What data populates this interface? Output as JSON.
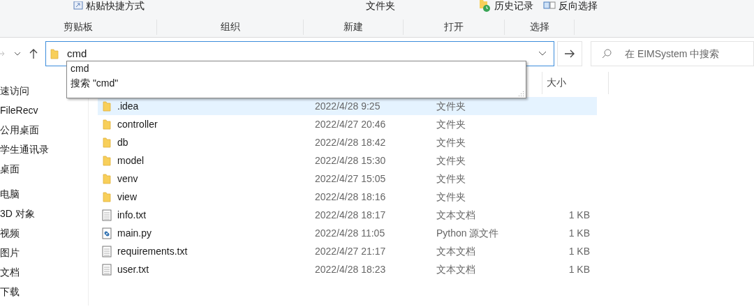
{
  "ribbon": {
    "top_items": [
      {
        "label": "粘贴快捷方式",
        "kind": "shortcut"
      },
      {
        "label": "文件夹",
        "kind": "plain"
      },
      {
        "label": "历史记录",
        "kind": "history"
      },
      {
        "label": "反向选择",
        "kind": "select"
      }
    ],
    "groups": [
      "剪贴板",
      "组织",
      "新建",
      "打开",
      "选择"
    ]
  },
  "address": {
    "value": "cmd",
    "suggestions": [
      {
        "label": "cmd"
      },
      {
        "label": "搜索 \"cmd\""
      }
    ]
  },
  "search": {
    "placeholder": "在 EIMSystem 中搜索"
  },
  "sidebar": {
    "items": [
      "速访问",
      "FileRecv",
      "公用桌面",
      "学生通讯录",
      "桌面",
      "电脑",
      "3D 对象",
      "视频",
      "图片",
      "文档",
      "下载"
    ]
  },
  "table": {
    "columns": [
      "大小"
    ],
    "rows": [
      {
        "kind": "folder",
        "name": ".idea",
        "date": "2022/4/28 9:25",
        "type": "文件夹",
        "selected": true
      },
      {
        "kind": "folder",
        "name": "controller",
        "date": "2022/4/27 20:46",
        "type": "文件夹",
        "selected": false
      },
      {
        "kind": "folder",
        "name": "db",
        "date": "2022/4/28 18:42",
        "type": "文件夹",
        "selected": false
      },
      {
        "kind": "folder",
        "name": "model",
        "date": "2022/4/28 15:30",
        "type": "文件夹",
        "selected": false
      },
      {
        "kind": "folder",
        "name": "venv",
        "date": "2022/4/27 15:05",
        "type": "文件夹",
        "selected": false
      },
      {
        "kind": "folder",
        "name": "view",
        "date": "2022/4/28 18:16",
        "type": "文件夹",
        "selected": false
      },
      {
        "kind": "text",
        "name": "info.txt",
        "date": "2022/4/28 18:17",
        "type": "文本文档",
        "size": "1 KB",
        "selected": false
      },
      {
        "kind": "python",
        "name": "main.py",
        "date": "2022/4/28 11:05",
        "type": "Python 源文件",
        "size": "1 KB",
        "selected": false
      },
      {
        "kind": "text",
        "name": "requirements.txt",
        "date": "2022/4/27 21:17",
        "type": "文本文档",
        "size": "1 KB",
        "selected": false
      },
      {
        "kind": "text",
        "name": "user.txt",
        "date": "2022/4/28 18:23",
        "type": "文本文档",
        "size": "1 KB",
        "selected": false
      }
    ]
  }
}
